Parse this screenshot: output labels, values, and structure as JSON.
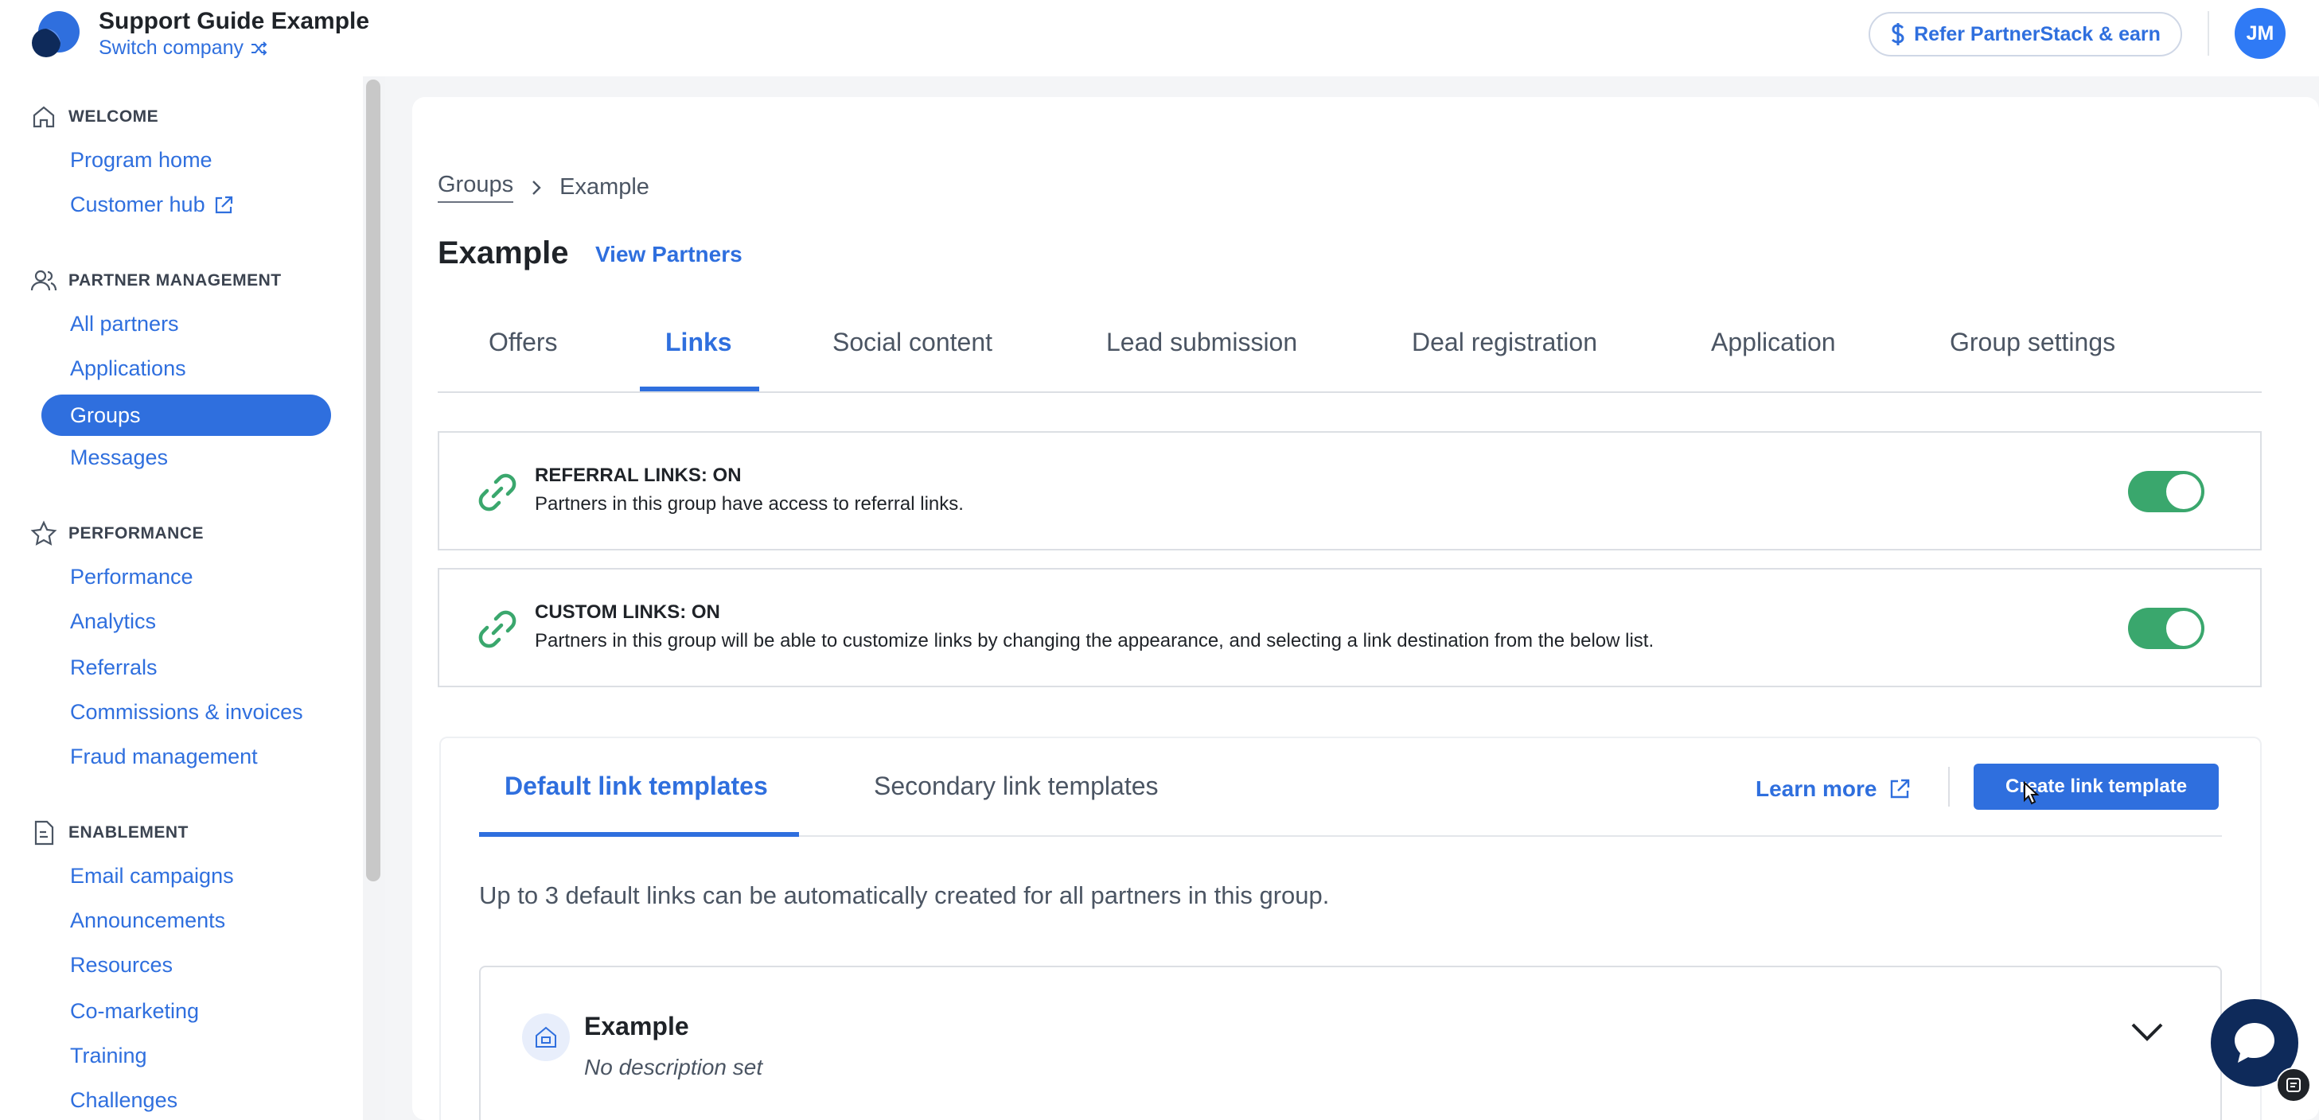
{
  "header": {
    "company_name": "Support Guide Example",
    "switch_company_label": "Switch company",
    "refer_label": "Refer PartnerStack & earn",
    "avatar_initials": "JM"
  },
  "sidebar": {
    "sections": [
      {
        "title": "WELCOME",
        "icon": "home-icon",
        "items": [
          {
            "label": "Program home"
          },
          {
            "label": "Customer hub",
            "icon": "external-link-icon"
          }
        ]
      },
      {
        "title": "PARTNER MANAGEMENT",
        "icon": "users-icon",
        "items": [
          {
            "label": "All partners"
          },
          {
            "label": "Applications"
          },
          {
            "label": "Groups",
            "active": true
          },
          {
            "label": "Messages"
          }
        ]
      },
      {
        "title": "PERFORMANCE",
        "icon": "star-icon",
        "items": [
          {
            "label": "Performance"
          },
          {
            "label": "Analytics"
          },
          {
            "label": "Referrals"
          },
          {
            "label": "Commissions & invoices"
          },
          {
            "label": "Fraud management"
          }
        ]
      },
      {
        "title": "ENABLEMENT",
        "icon": "document-icon",
        "items": [
          {
            "label": "Email campaigns"
          },
          {
            "label": "Announcements"
          },
          {
            "label": "Resources"
          },
          {
            "label": "Co-marketing"
          },
          {
            "label": "Training"
          },
          {
            "label": "Challenges"
          }
        ]
      }
    ]
  },
  "breadcrumb": {
    "parent": "Groups",
    "current": "Example"
  },
  "page": {
    "title": "Example",
    "view_partners": "View Partners"
  },
  "tabs": [
    "Offers",
    "Links",
    "Social content",
    "Lead submission",
    "Deal registration",
    "Application",
    "Group settings"
  ],
  "active_tab": "Links",
  "panels": {
    "referral": {
      "title": "REFERRAL LINKS: ON",
      "description": "Partners in this group have access to referral links.",
      "enabled": true
    },
    "custom": {
      "title": "CUSTOM LINKS: ON",
      "description": "Partners in this group will be able to customize links by changing the appearance, and selecting a link destination from the below list.",
      "enabled": true
    }
  },
  "templates": {
    "tabs": [
      "Default link templates",
      "Secondary link templates"
    ],
    "active_tab": "Default link templates",
    "learn_more": "Learn more",
    "create_button": "Create link template",
    "description": "Up to 3 default links can be automatically created for all partners in this group.",
    "items": [
      {
        "title": "Example",
        "description": "No description set"
      }
    ]
  },
  "colors": {
    "accent": "#2f6fde",
    "toggle_on": "#3aa76d",
    "chat": "#0e2a5a"
  }
}
